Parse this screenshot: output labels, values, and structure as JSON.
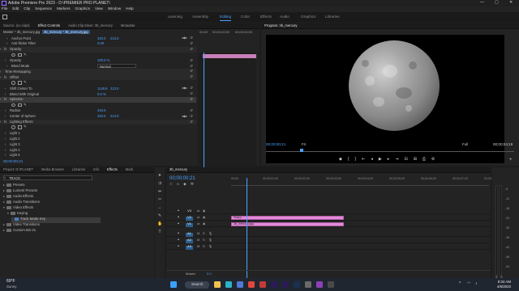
{
  "window": {
    "title": "Adobe Premiere Pro 2023 - D:\\PREMIER PRO PLANET\\",
    "controls": [
      "—",
      "▢",
      "✕"
    ]
  },
  "menubar": [
    "File",
    "Edit",
    "Clip",
    "Sequence",
    "Markers",
    "Graphics",
    "View",
    "Window",
    "Help"
  ],
  "workspaces": [
    {
      "label": "Learning",
      "active": false
    },
    {
      "label": "Assembly",
      "active": false
    },
    {
      "label": "Editing",
      "active": true
    },
    {
      "label": "Color",
      "active": false
    },
    {
      "label": "Effects",
      "active": false
    },
    {
      "label": "Audio",
      "active": false
    },
    {
      "label": "Graphics",
      "active": false
    },
    {
      "label": "Libraries",
      "active": false
    }
  ],
  "source_panel": {
    "tabs": [
      "Source: (no clips)",
      "Effect Controls",
      "Audio Clip Mixer: 3b_mercury",
      "Metadata"
    ],
    "active_tab": "Effect Controls",
    "breadcrumb_master": "Master * 3b_mercury.jpg",
    "breadcrumb_seq": "3b_mercury * 3b_mercury.jpg",
    "timecodes": [
      "00;00",
      "00;00;02;00",
      "00;00;04;00"
    ],
    "rows": [
      {
        "label": "Anchor Point",
        "indent": 12,
        "v1": "320.0",
        "v2": "213.0",
        "kind": "val"
      },
      {
        "label": "Anti-flicker Filter",
        "indent": 12,
        "v1": "0.00",
        "kind": "val"
      },
      {
        "label": "Opacity",
        "indent": 4,
        "kind": "hdr",
        "fx": true
      },
      {
        "label": "",
        "indent": 14,
        "kind": "shapes"
      },
      {
        "label": "Opacity",
        "indent": 10,
        "v1": "100.0 %",
        "kind": "val"
      },
      {
        "label": "Blend Mode",
        "indent": 12,
        "sel": "Normal",
        "kind": "sel"
      },
      {
        "label": "Time Remapping",
        "indent": 4,
        "kind": "hdr"
      },
      {
        "label": "Offset",
        "indent": 4,
        "kind": "hdr",
        "fx": true
      },
      {
        "label": "",
        "indent": 14,
        "kind": "shapes"
      },
      {
        "label": "Shift Center To",
        "indent": 10,
        "v1": "1148.6",
        "v2": "213.0",
        "kind": "val"
      },
      {
        "label": "Blend With Original",
        "indent": 10,
        "v1": "0.0 %",
        "kind": "val"
      },
      {
        "label": "Spherize",
        "indent": 4,
        "kind": "hdr",
        "fx": true,
        "hl": true
      },
      {
        "label": "",
        "indent": 14,
        "kind": "shapes"
      },
      {
        "label": "Radius",
        "indent": 10,
        "v1": "434.5",
        "kind": "val"
      },
      {
        "label": "Center of Sphere",
        "indent": 10,
        "v1": "320.0",
        "v2": "213.0",
        "kind": "val"
      },
      {
        "label": "Lighting Effects",
        "indent": 4,
        "kind": "hdr",
        "fx": true
      },
      {
        "label": "",
        "indent": 14,
        "kind": "shapes"
      },
      {
        "label": "Light 1",
        "indent": 10,
        "kind": "plain"
      },
      {
        "label": "Light 2",
        "indent": 10,
        "kind": "plain"
      },
      {
        "label": "Light 3",
        "indent": 10,
        "kind": "plain"
      },
      {
        "label": "Light 4",
        "indent": 10,
        "kind": "plain"
      },
      {
        "label": "Light 5",
        "indent": 10,
        "kind": "plain"
      }
    ],
    "footer_timecode": "00;00;00;21"
  },
  "program_monitor": {
    "title": "Program: 3b_mercury",
    "timecode": "00;00;00;21",
    "fit": "Fit",
    "quality": "Full",
    "duration": "00;00;04;19"
  },
  "project_panel": {
    "tabs": [
      "Project: D:\\PLANET",
      "Media Browser",
      "Libraries",
      "Info",
      "Effects",
      "Mark"
    ],
    "active_tab": "Effects",
    "search": "TRACK",
    "tree": [
      {
        "label": "Presets",
        "depth": 0,
        "folder": true
      },
      {
        "label": "Lumetri Presets",
        "depth": 0,
        "folder": true
      },
      {
        "label": "Audio Effects",
        "depth": 0,
        "folder": true
      },
      {
        "label": "Audio Transitions",
        "depth": 0,
        "folder": true
      },
      {
        "label": "Video Effects",
        "depth": 0,
        "folder": true,
        "open": true
      },
      {
        "label": "Keying",
        "depth": 1,
        "folder": true,
        "open": true
      },
      {
        "label": "Track Matte Key",
        "depth": 2,
        "folder": false,
        "selected": true
      },
      {
        "label": "Video Transitions",
        "depth": 0,
        "folder": true
      },
      {
        "label": "Custom Bin 01",
        "depth": 0,
        "folder": true
      }
    ]
  },
  "timeline": {
    "tab": "3b_mercury",
    "timecode": "00;00;00;21",
    "ticks": [
      "00;00",
      "00;00;01;00",
      "00;00;02;00",
      "00;00;03;00",
      "00;00;04;00",
      "00;00;05;00",
      "00;00;06;00",
      "00;00;07;00",
      "00;00;08;00"
    ],
    "tracks": [
      {
        "name": "V3",
        "type": "video"
      },
      {
        "name": "V2",
        "type": "video",
        "clip": "Sharp"
      },
      {
        "name": "V1",
        "type": "video",
        "clip": "3b_mercury.jpg"
      },
      {
        "name": "A1",
        "type": "audio"
      },
      {
        "name": "A2",
        "type": "audio"
      },
      {
        "name": "A3",
        "type": "audio"
      }
    ],
    "master": {
      "label": "Master",
      "value": "0.0"
    }
  },
  "meter": {
    "scale": [
      "-6",
      "-12",
      "-18",
      "-24",
      "-30",
      "-36",
      "-42",
      "-48",
      "-54"
    ],
    "labels": [
      "S",
      "S"
    ]
  },
  "taskbar": {
    "weather_temp": "69°F",
    "weather_desc": "Sunny",
    "search_label": "Search",
    "time": "8:34 AM",
    "date": "4/6/2023",
    "apps": [
      {
        "name": "windows-start",
        "color": "#3aa0ff"
      },
      {
        "name": "file-explorer",
        "color": "#f2c14e"
      },
      {
        "name": "edge",
        "color": "#2bb3c8"
      },
      {
        "name": "store",
        "color": "#4e7ad6"
      },
      {
        "name": "chrome",
        "color": "#e1483d"
      },
      {
        "name": "app-1",
        "color": "#c43a3a"
      },
      {
        "name": "premiere-pro",
        "color": "#2b1a55"
      },
      {
        "name": "after-effects",
        "color": "#2b1a55"
      },
      {
        "name": "photoshop",
        "color": "#1b2f4e"
      },
      {
        "name": "app-2",
        "color": "#6a6a6a"
      },
      {
        "name": "app-3",
        "color": "#8e3fb8"
      },
      {
        "name": "app-4",
        "color": "#4a4a4a"
      }
    ]
  }
}
